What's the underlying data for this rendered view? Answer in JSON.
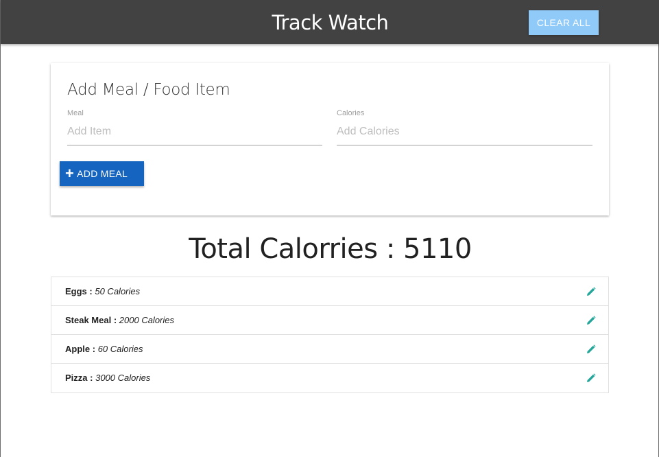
{
  "navbar": {
    "title": "Track Watch",
    "clear_all_label": "CLEAR ALL"
  },
  "form": {
    "title": "Add Meal / Food Item",
    "meal_label": "Meal",
    "meal_placeholder": "Add Item",
    "meal_value": "",
    "calories_label": "Calories",
    "calories_placeholder": "Add Calories",
    "calories_value": "",
    "add_button_icon": "plus-icon",
    "add_button_label": "ADD MEAL"
  },
  "total": {
    "text": "Total Calorries : 5110"
  },
  "items": [
    {
      "name": "Eggs :",
      "calories": "50 Calories",
      "icon": "pencil-icon"
    },
    {
      "name": "Steak Meal :",
      "calories": "2000 Calories",
      "icon": "pencil-icon"
    },
    {
      "name": "Apple :",
      "calories": "60 Calories",
      "icon": "pencil-icon"
    },
    {
      "name": "Pizza :",
      "calories": "3000 Calories",
      "icon": "pencil-icon"
    }
  ],
  "colors": {
    "navbar": "#424242",
    "clear_button": "#90caf9",
    "add_button": "#1565c0",
    "edit_icon": "#26a69a"
  }
}
